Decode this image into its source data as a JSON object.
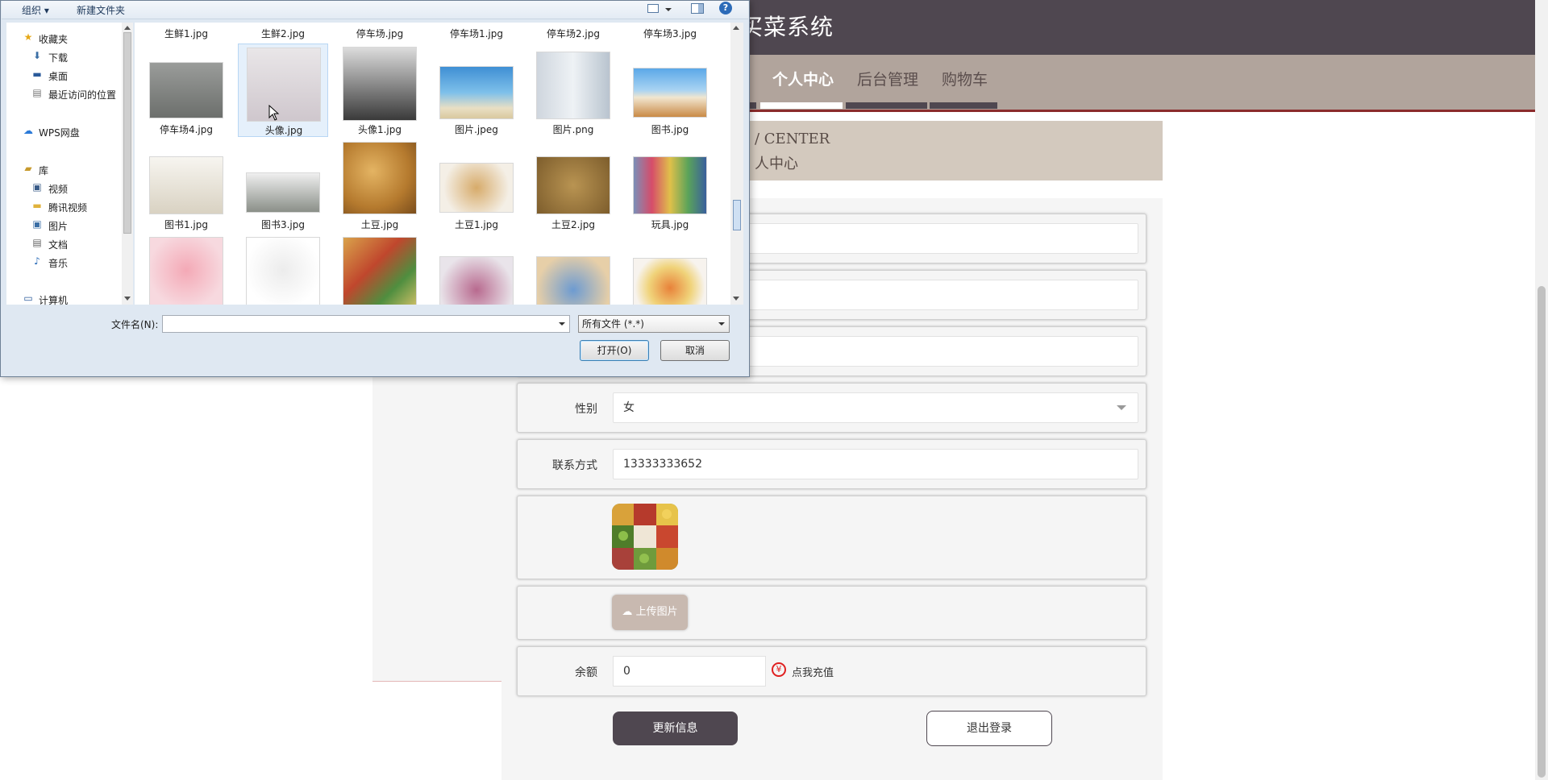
{
  "site": {
    "title_visible": "买菜系统",
    "nav": [
      "个人中心",
      "后台管理",
      "购物车"
    ],
    "banner_en": "/ CENTER",
    "banner_cn": "人中心"
  },
  "form": {
    "gender_label": "性别",
    "gender_value": "女",
    "contact_label": "联系方式",
    "contact_value": "13333333652",
    "upload_label": "上传图片",
    "balance_label": "余额",
    "balance_value": "0",
    "recharge_icon": "¥",
    "recharge_text": "点我充值",
    "update_button": "更新信息",
    "logout_button": "退出登录"
  },
  "dialog": {
    "toolbar": {
      "organize": "组织 ▾",
      "new_folder": "新建文件夹",
      "help": "?"
    },
    "nav": [
      {
        "icon": "star-icon",
        "label": "收藏夹"
      },
      {
        "icon": "download-icon",
        "label": "下载"
      },
      {
        "icon": "desktop-icon",
        "label": "桌面"
      },
      {
        "icon": "recent-places-icon",
        "label": "最近访问的位置"
      },
      {
        "icon": "cloud-icon",
        "label": "WPS网盘"
      },
      {
        "icon": "library-icon",
        "label": "库"
      },
      {
        "icon": "video-icon",
        "label": "视频"
      },
      {
        "icon": "folder-icon",
        "label": "腾讯视频"
      },
      {
        "icon": "picture-icon",
        "label": "图片"
      },
      {
        "icon": "document-icon",
        "label": "文档"
      },
      {
        "icon": "music-icon",
        "label": "音乐"
      },
      {
        "icon": "computer-icon",
        "label": "计算机"
      }
    ],
    "files_row0": [
      "生鲜1.jpg",
      "生鲜2.jpg",
      "停车场.jpg",
      "停车场1.jpg",
      "停车场2.jpg",
      "停车场3.jpg"
    ],
    "files_row1": [
      "停车场4.jpg",
      "头像.jpg",
      "头像1.jpg",
      "图片.jpeg",
      "图片.png",
      "图书.jpg"
    ],
    "files_row2": [
      "图书1.jpg",
      "图书3.jpg",
      "土豆.jpg",
      "土豆1.jpg",
      "土豆2.jpg",
      "玩具.jpg"
    ],
    "filename_label": "文件名(N):",
    "filename_value": "",
    "filter_value": "所有文件 (*.*)",
    "open_button": "打开(O)",
    "cancel_button": "取消"
  }
}
